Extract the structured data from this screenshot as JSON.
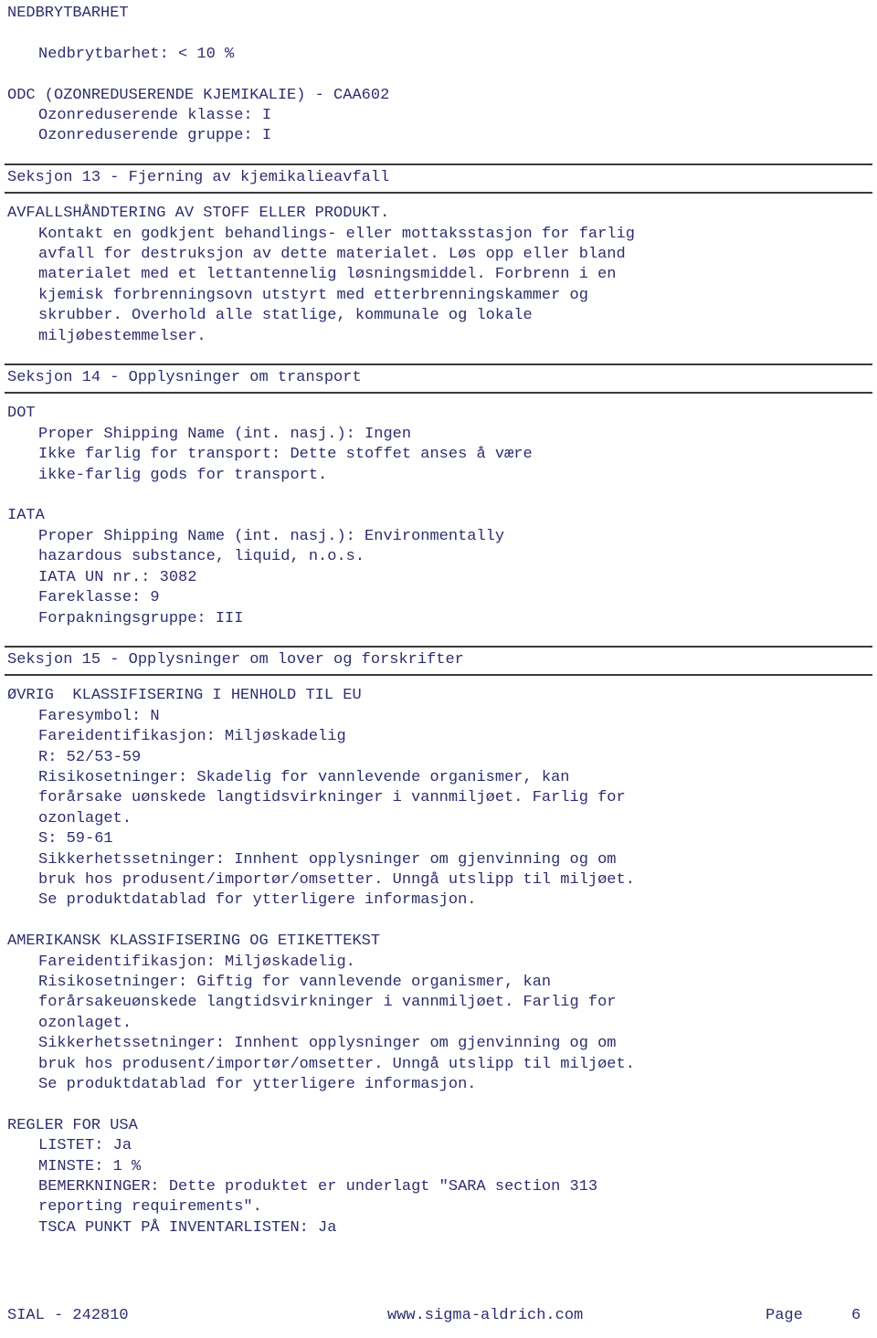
{
  "document": {
    "text_color": "#2e2e6e",
    "rule_color": "#3a3a3a",
    "background": "#ffffff"
  },
  "biodegradability": {
    "heading": "NEDBRYTBARHET",
    "value_line": "Nedbrytbarhet: < 10 %"
  },
  "odc": {
    "heading": "ODC (OZONREDUSERENDE KJEMIKALIE) - CAA602",
    "lines": [
      "Ozonreduserende klasse: I",
      "Ozonreduserende gruppe: I"
    ]
  },
  "section13": {
    "title": "Seksjon 13 - Fjerning av kjemikalieavfall",
    "subheading": "AVFALLSHÅNDTERING AV STOFF ELLER PRODUKT.",
    "body_lines": [
      "Kontakt en godkjent behandlings- eller mottaksstasjon for farlig",
      "avfall for destruksjon av dette materialet. Løs opp eller bland",
      "materialet med et lettantennelig løsningsmiddel. Forbrenn i en",
      "kjemisk forbrenningsovn utstyrt med etterbrenningskammer og",
      "skrubber. Overhold alle statlige, kommunale og lokale",
      "miljøbestemmelser."
    ]
  },
  "section14": {
    "title": "Seksjon 14 - Opplysninger om transport",
    "dot": {
      "label": "DOT",
      "lines": [
        "Proper Shipping Name (int. nasj.): Ingen",
        "Ikke farlig for transport: Dette stoffet anses å være",
        "ikke-farlig gods for transport."
      ]
    },
    "iata": {
      "label": "IATA",
      "lines": [
        "Proper Shipping Name (int. nasj.): Environmentally",
        "hazardous substance, liquid, n.o.s.",
        "IATA UN nr.: 3082",
        "Fareklasse: 9",
        "Forpakningsgruppe: III"
      ]
    }
  },
  "section15": {
    "title": "Seksjon 15 - Opplysninger om lover og forskrifter",
    "eu": {
      "heading": "ØVRIG  KLASSIFISERING I HENHOLD TIL EU",
      "lines": [
        "Faresymbol: N",
        "Fareidentifikasjon: Miljøskadelig",
        "R: 52/53-59",
        "Risikosetninger: Skadelig for vannlevende organismer, kan",
        "forårsake uønskede langtidsvirkninger i vannmiljøet. Farlig for",
        "ozonlaget.",
        "S: 59-61",
        "Sikkerhetssetninger: Innhent opplysninger om gjenvinning og om",
        "bruk hos produsent/importør/omsetter. Unngå utslipp til miljøet.",
        "Se produktdatablad for ytterligere informasjon."
      ]
    },
    "american": {
      "heading": "AMERIKANSK KLASSIFISERING OG ETIKETTEKST",
      "lines": [
        "Fareidentifikasjon: Miljøskadelig.",
        "Risikosetninger: Giftig for vannlevende organismer, kan",
        "forårsakeuønskede langtidsvirkninger i vannmiljøet. Farlig for",
        "ozonlaget.",
        "Sikkerhetssetninger: Innhent opplysninger om gjenvinning og om",
        "bruk hos produsent/importør/omsetter. Unngå utslipp til miljøet.",
        "Se produktdatablad for ytterligere informasjon."
      ]
    },
    "usa_regulations": {
      "heading": "REGLER FOR USA",
      "lines": [
        "LISTET: Ja",
        "MINSTE: 1 %",
        "BEMERKNINGER: Dette produktet er underlagt \"SARA section 313",
        "reporting requirements\".",
        "TSCA PUNKT PÅ INVENTARLISTEN: Ja"
      ]
    }
  },
  "footer": {
    "product_code": "SIAL - 242810",
    "website": "www.sigma-aldrich.com",
    "page_label": "Page",
    "page_number": "6"
  }
}
